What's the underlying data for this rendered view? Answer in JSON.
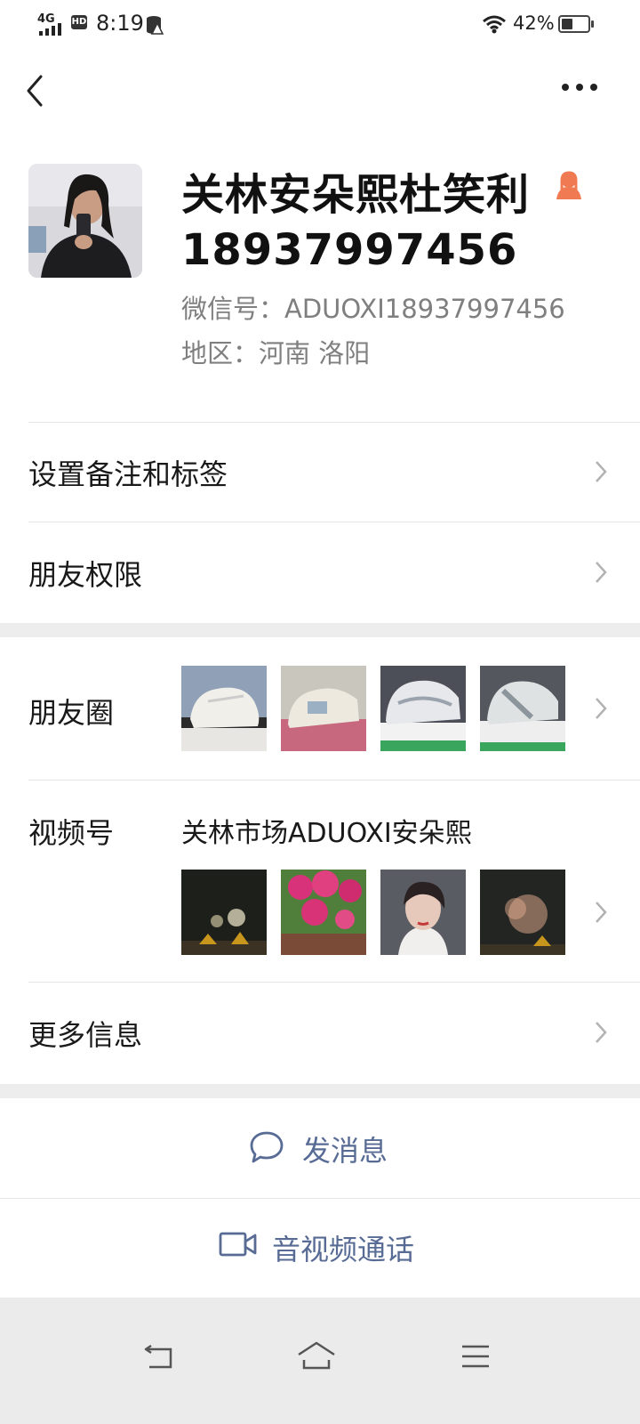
{
  "status_bar": {
    "network": "4G",
    "hd_badge": "HD",
    "time": "8:19",
    "battery_percent": "42%",
    "battery_level": 0.42
  },
  "nav": {
    "back_icon": "chevron-left-icon",
    "more_icon": "more-dots-icon"
  },
  "profile": {
    "name_line1": "关林安朵熙杜笑利",
    "name_line2": "18937997456",
    "wechat_id": "微信号：ADUOXI18937997456",
    "region": "地区：河南  洛阳",
    "gender_icon": "female-icon"
  },
  "menu": {
    "remark_tags": "设置备注和标签",
    "friend_permissions": "朋友权限",
    "moments": "朋友圈",
    "channels": "视频号",
    "channels_name": "关林市场ADUOXI安朵熙",
    "more_info": "更多信息"
  },
  "actions": {
    "send_message": "发消息",
    "video_call": "音视频通话"
  },
  "colors": {
    "accent": "#576b95",
    "gender_badge": "#f07a52",
    "background": "#ededed"
  }
}
